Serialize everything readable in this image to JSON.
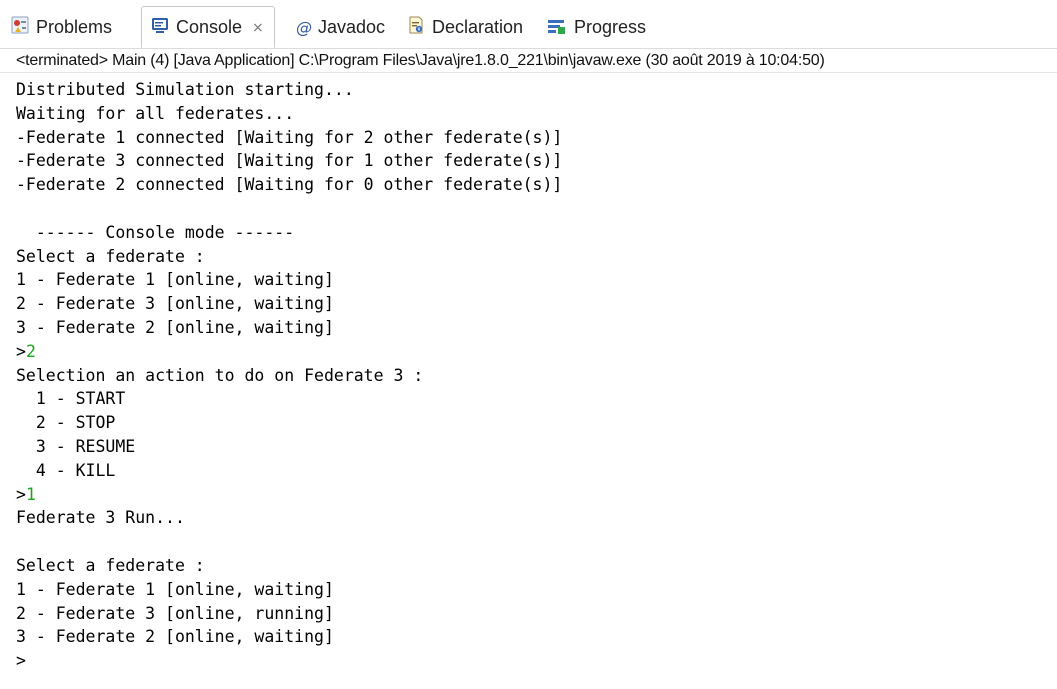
{
  "tabs": [
    {
      "label": "Problems",
      "icon": "problems-icon"
    },
    {
      "label": "Console",
      "icon": "console-icon",
      "active": true,
      "close": "⨯"
    },
    {
      "label": "Javadoc",
      "icon": "javadoc-icon"
    },
    {
      "label": "Declaration",
      "icon": "declaration-icon"
    },
    {
      "label": "Progress",
      "icon": "progress-icon"
    }
  ],
  "status": "<terminated> Main (4) [Java Application] C:\\Program Files\\Java\\jre1.8.0_221\\bin\\javaw.exe (30 août 2019 à 10:04:50)",
  "console": {
    "lines": [
      "Distributed Simulation starting...",
      "Waiting for all federates...",
      "-Federate 1 connected [Waiting for 2 other federate(s)]",
      "-Federate 3 connected [Waiting for 1 other federate(s)]",
      "-Federate 2 connected [Waiting for 0 other federate(s)]",
      "",
      "  ------ Console mode ------",
      "Select a federate :",
      "1 - Federate 1 [online, waiting]",
      "2 - Federate 3 [online, waiting]",
      "3 - Federate 2 [online, waiting]",
      {
        "prompt": ">",
        "input": "2"
      },
      "Selection an action to do on Federate 3 :",
      "  1 - START",
      "  2 - STOP",
      "  3 - RESUME",
      "  4 - KILL",
      {
        "prompt": ">",
        "input": "1"
      },
      "Federate 3 Run...",
      "",
      "Select a federate :",
      "1 - Federate 1 [online, waiting]",
      "2 - Federate 3 [online, running]",
      "3 - Federate 2 [online, waiting]",
      {
        "prompt": ">",
        "input": ""
      }
    ]
  },
  "colors": {
    "input_text": "#1aa51a"
  }
}
